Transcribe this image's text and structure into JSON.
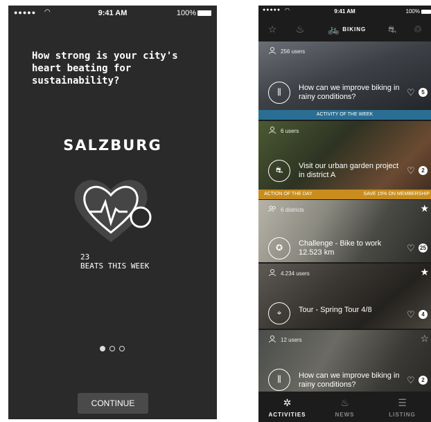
{
  "onboarding": {
    "status_bar": {
      "signal": "●●●●●",
      "time": "9:41 AM",
      "battery": "100%"
    },
    "question": "How strong is your city's heart beating for sustainability?",
    "city": "SALZBURG",
    "beats_count": "23",
    "beats_label": "BEATS THIS WEEK",
    "page_indicator": {
      "pages": 3,
      "current": 1
    },
    "continue_label": "CONTINUE"
  },
  "feed": {
    "status_bar": {
      "signal": "●●●●●",
      "time": "9:41 AM",
      "battery": "100%"
    },
    "categories": [
      {
        "icon": "star-icon",
        "label": ""
      },
      {
        "icon": "flame-icon",
        "label": ""
      },
      {
        "icon": "bike-icon",
        "label": "BIKING",
        "selected": true
      },
      {
        "icon": "car-icon",
        "label": ""
      },
      {
        "icon": "handshake-icon",
        "label": ""
      }
    ],
    "cards": [
      {
        "users": "256 users",
        "title": "How can we improve biking in rainy conditions?",
        "count": "5",
        "strip_left": "ACTIVITY OF THE WEEK",
        "strip_right": "",
        "border": "#3ab0e6",
        "icon": "sliders-icon",
        "star": ""
      },
      {
        "users": "6 users",
        "title": "Visit our urban garden project in district A",
        "count": "2",
        "strip_left": "ACTION OF THE DAY",
        "strip_right": "SAVE 15% ON MEMBERSHIP",
        "border": "#e2a22a",
        "icon": "car-icon",
        "star": ""
      },
      {
        "users": "6 districts",
        "title": "Challenge - Bike to work 12.523 km",
        "count": "25",
        "strip_left": "",
        "strip_right": "",
        "border": "",
        "icon": "medal-icon",
        "star": "filled"
      },
      {
        "users": "4.234 users",
        "title": "Tour - Spring Tour 4/8",
        "count": "4",
        "strip_left": "",
        "strip_right": "",
        "border": "",
        "icon": "map-pin-icon",
        "star": "filled"
      },
      {
        "users": "12 users",
        "title": "How can we improve biking in rainy conditions?",
        "count": "2",
        "strip_left": "",
        "strip_right": "",
        "border": "",
        "icon": "sliders-icon",
        "star": "outline"
      }
    ],
    "tabs": [
      {
        "label": "ACTIVITIES",
        "icon": "activities-icon",
        "selected": true
      },
      {
        "label": "NEWS",
        "icon": "flame-icon"
      },
      {
        "label": "LISTING",
        "icon": "listing-icon"
      }
    ]
  }
}
